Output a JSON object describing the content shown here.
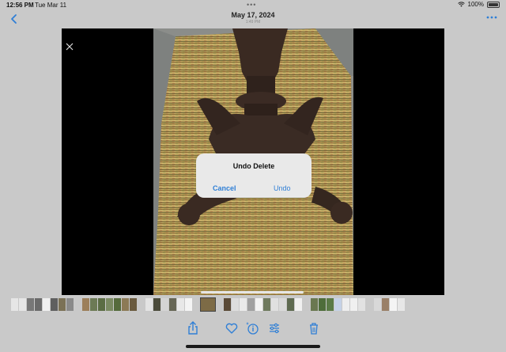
{
  "status_bar": {
    "time": "12:56 PM",
    "date": "Tue Mar 11",
    "battery": "100%"
  },
  "header": {
    "title": "May 17, 2024",
    "subtitle": "1:49 PM"
  },
  "icons": {
    "back": "chevron-left-icon",
    "more": "ellipsis-icon",
    "close": "close-icon",
    "share": "share-icon",
    "favorite": "heart-icon",
    "info": "info-sparkle-icon",
    "adjust": "sliders-icon",
    "delete": "trash-icon"
  },
  "dialog": {
    "title": "Undo Delete",
    "cancel_label": "Cancel",
    "undo_label": "Undo"
  },
  "colors": {
    "accent": "#2f7fd6",
    "background": "#c9c9c9",
    "dialog": "#e9e9e9"
  },
  "filmstrip": {
    "thumbs": [
      "#e6e6e6",
      "#e6e6e6",
      "#777777",
      "#6a6a6a",
      "#f0f0f0",
      "#5f5f5f",
      "#7b7156",
      "#8a8a8a",
      "#c9c9c9",
      "#9c7f5a",
      "#6c7a55",
      "#5b6d44",
      "#7a8a62",
      "#556b3c",
      "#8c7a56",
      "#6a5a3e",
      "#c9c9c9",
      "#e3e3e3",
      "#4b4b3b",
      "#d4d4d4",
      "#666655",
      "#e8e8e8",
      "#f4f4f4",
      "#c9c9c9",
      "#7d6b46",
      "#c9c9c9",
      "#5a4a37",
      "#dddddd",
      "#eaeaea",
      "#a0a0a0",
      "#f2f2f2",
      "#6f7a5e",
      "#e0e0e0",
      "#dadada",
      "#5e6a50",
      "#f0f0f0",
      "#c8c8c8",
      "#6a7850",
      "#4e6d3a",
      "#5a7a46",
      "#c5d2e6",
      "#eeeeee",
      "#f0f0f0",
      "#e2e2e2",
      "#c9c9c9",
      "#d8d8d8",
      "#9a8068",
      "#f4f4f4",
      "#e7e7e7"
    ]
  }
}
